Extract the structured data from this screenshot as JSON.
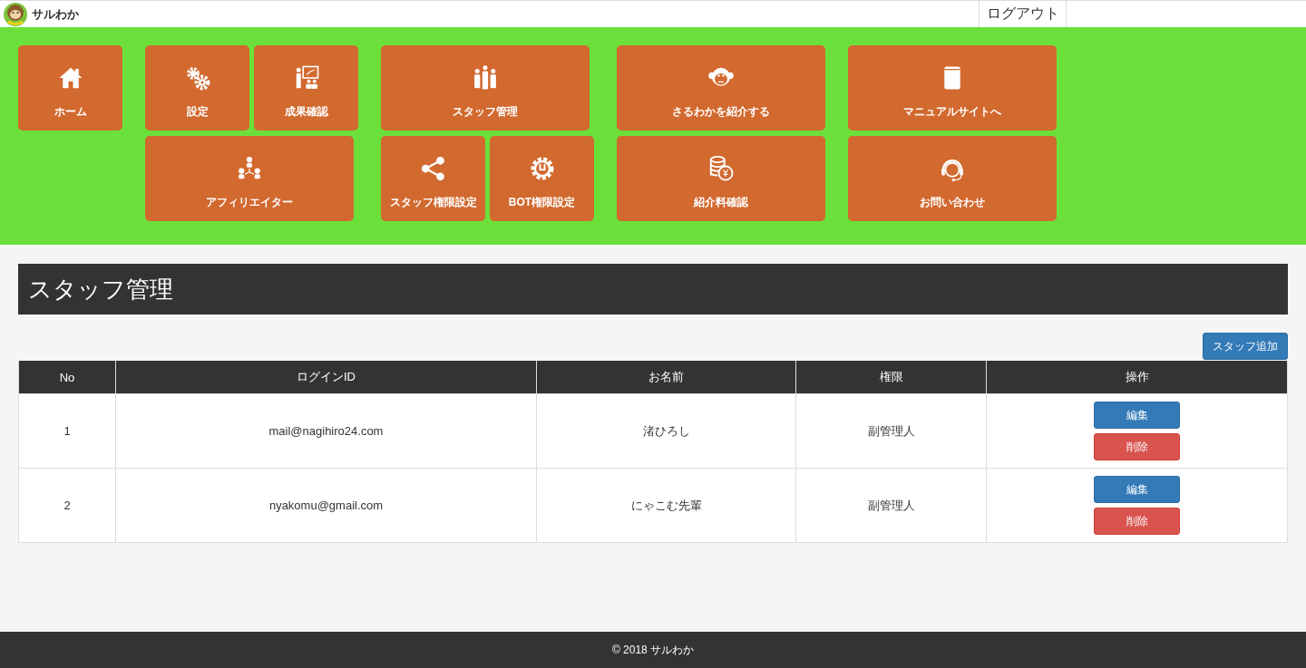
{
  "header": {
    "logo_text": "サルわか",
    "logout": "ログアウト"
  },
  "menu_groups": [
    {
      "rows": [
        [
          {
            "label": "ホーム"
          }
        ]
      ]
    },
    {
      "rows": [
        [
          {
            "label": "設定"
          },
          {
            "label": "成果確認"
          }
        ],
        [
          {
            "label": "アフィリエイター"
          }
        ]
      ]
    },
    {
      "rows": [
        [
          {
            "label": "スタッフ管理"
          }
        ],
        [
          {
            "label": "スタッフ権限設定"
          },
          {
            "label": "BOT権限設定"
          }
        ]
      ]
    },
    {
      "rows": [
        [
          {
            "label": "さるわかを紹介する"
          }
        ],
        [
          {
            "label": "紹介料確認"
          }
        ]
      ]
    },
    {
      "rows": [
        [
          {
            "label": "マニュアルサイトへ"
          }
        ],
        [
          {
            "label": "お問い合わせ"
          }
        ]
      ]
    }
  ],
  "page_title": "スタッフ管理",
  "add_button": "スタッフ追加",
  "table": {
    "columns": [
      "No",
      "ログインID",
      "お名前",
      "権限",
      "操作"
    ],
    "rows": [
      {
        "no": "1",
        "login_id": "mail@nagihiro24.com",
        "name": "渚ひろし",
        "role": "副管理人",
        "edit": "編集",
        "delete": "削除"
      },
      {
        "no": "2",
        "login_id": "nyakomu@gmail.com",
        "name": "にゃこむ先輩",
        "role": "副管理人",
        "edit": "編集",
        "delete": "削除"
      }
    ]
  },
  "footer": {
    "copyright": "© 2018 サルわか"
  }
}
